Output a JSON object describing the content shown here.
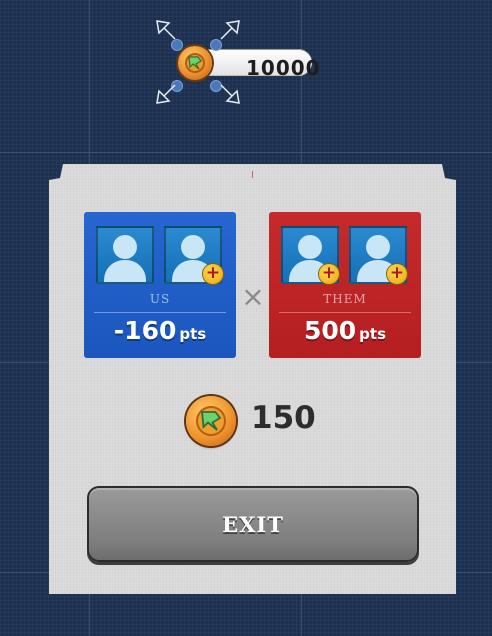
{
  "hud": {
    "coin_balance": "10000",
    "coin_icon": "coin-icon"
  },
  "match": {
    "teams": [
      {
        "label": "US",
        "score": "-160",
        "unit": "pts",
        "color": "#1f5dc8"
      },
      {
        "label": "THEM",
        "score": "500",
        "unit": "pts",
        "color": "#bd2427"
      }
    ],
    "versus_symbol": "×"
  },
  "reward": {
    "amount": "150",
    "icon": "coin-icon"
  },
  "actions": {
    "exit_label": "EXIT"
  }
}
